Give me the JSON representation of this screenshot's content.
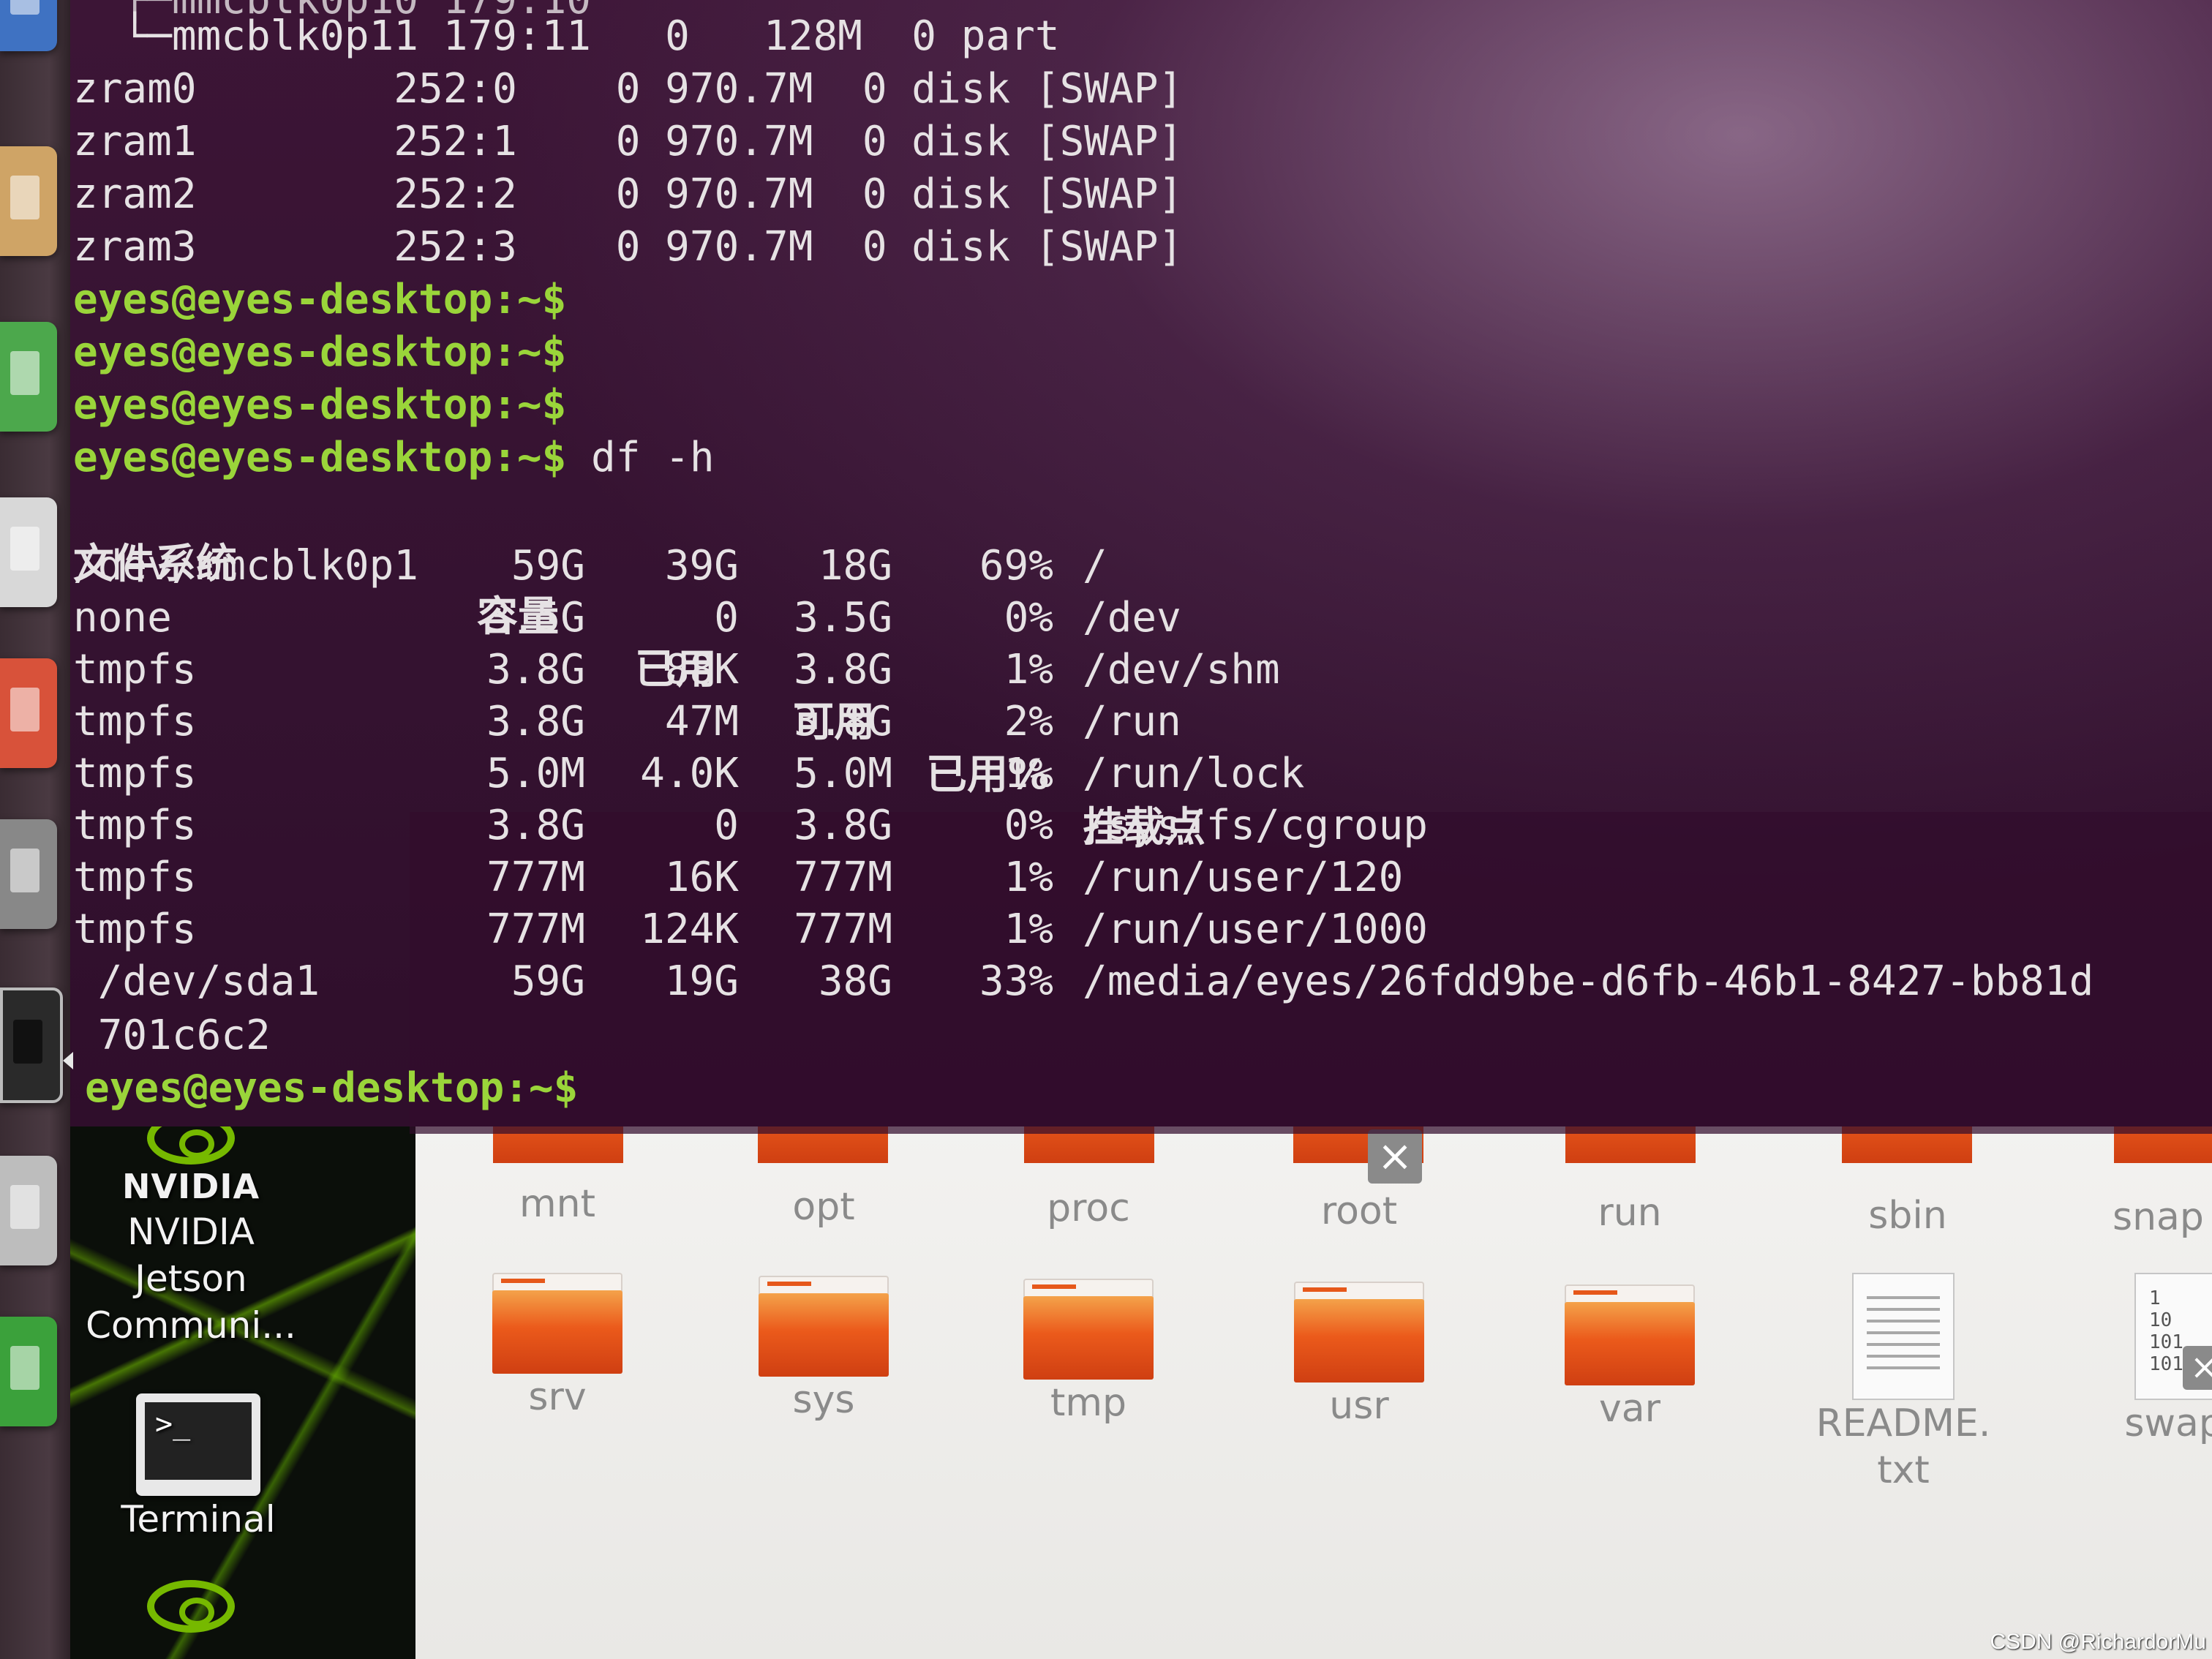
{
  "terminal": {
    "lsblk_rows": [
      "  └─mmcblk0p11 179:11   0   128M  0 part",
      "zram0        252:0    0 970.7M  0 disk [SWAP]",
      "zram1        252:1    0 970.7M  0 disk [SWAP]",
      "zram2        252:2    0 970.7M  0 disk [SWAP]",
      "zram3        252:3    0 970.7M  0 disk [SWAP]"
    ],
    "prompt": "eyes@eyes-desktop:~$",
    "command": " df -h",
    "df_header": [
      "文件系统",
      "容量",
      "已用",
      "可用",
      "已用%",
      "挂载点"
    ],
    "df_rows": [
      [
        "/dev/mmcblk0p1",
        "59G",
        "39G",
        "18G",
        "69%",
        "/"
      ],
      [
        "none",
        "3.5G",
        "0",
        "3.5G",
        "0%",
        "/dev"
      ],
      [
        "tmpfs",
        "3.8G",
        "88K",
        "3.8G",
        "1%",
        "/dev/shm"
      ],
      [
        "tmpfs",
        "3.8G",
        "47M",
        "3.8G",
        "2%",
        "/run"
      ],
      [
        "tmpfs",
        "5.0M",
        "4.0K",
        "5.0M",
        "1%",
        "/run/lock"
      ],
      [
        "tmpfs",
        "3.8G",
        "0",
        "3.8G",
        "0%",
        "/sys/fs/cgroup"
      ],
      [
        "tmpfs",
        "777M",
        "16K",
        "777M",
        "1%",
        "/run/user/120"
      ],
      [
        "tmpfs",
        "777M",
        "124K",
        "777M",
        "1%",
        "/run/user/1000"
      ],
      [
        " /dev/sda1",
        "59G",
        "19G",
        "38G",
        "33%",
        "/media/eyes/26fdd9be-d6fb-46b1-8427-bb81d"
      ]
    ],
    "wrapped_tail": " 701c6c2"
  },
  "desktop": {
    "icons": [
      {
        "line1": "NVIDIA",
        "line2": "NVIDIA",
        "line3": "Jetson",
        "line4": "Communi..."
      },
      {
        "label": "Terminal"
      }
    ]
  },
  "file_manager": {
    "row1": [
      "mnt",
      "opt",
      "proc",
      "root",
      "run",
      "sbin",
      "snap"
    ],
    "row2": [
      "srv",
      "sys",
      "tmp",
      "usr",
      "var"
    ],
    "readme": "README.txt",
    "readme_l1": "README.",
    "readme_l2": "txt",
    "swap": "swapfi"
  },
  "watermark": "CSDN @RichardorMu",
  "colors": {
    "prompt": "#9ad53a",
    "terminal_bg": "#341230",
    "folder": "#eb5a1b",
    "nvidia": "#76b900"
  }
}
